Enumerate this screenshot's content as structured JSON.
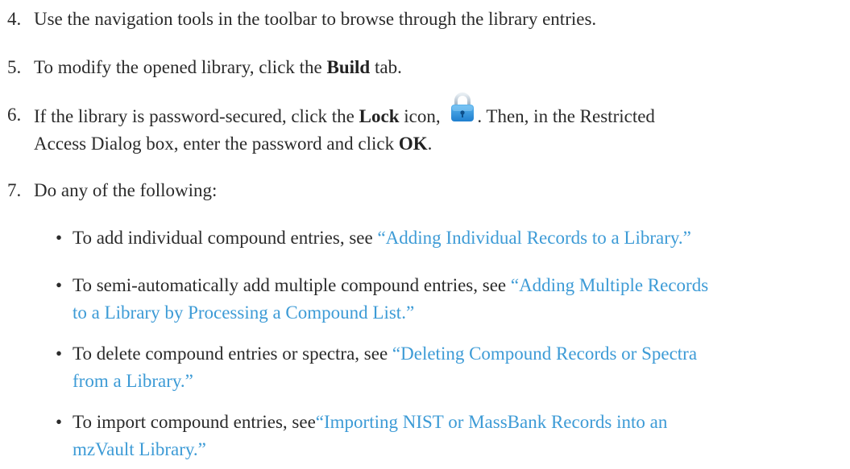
{
  "steps": [
    {
      "number": "4.",
      "text": "Use the navigation tools in the toolbar to browse through the library entries."
    },
    {
      "number": "5.",
      "pre": "To modify the opened library, click the ",
      "bold": "Build",
      "post": " tab."
    },
    {
      "number": "6.",
      "pre": "If the library is password-secured, click the ",
      "bold_lock": "Lock",
      "mid": " icon, ",
      "post1": ". Then, in the Restricted",
      "line2_pre": "Access Dialog box, enter the password and click ",
      "bold_ok": "OK",
      "line2_post": "."
    },
    {
      "number": "7.",
      "text": "Do any of the following:"
    }
  ],
  "bullets": [
    {
      "glyph": "•",
      "pre": "To add individual compound entries, see ",
      "link": "“Adding Individual Records to a Library.”"
    },
    {
      "glyph": "•",
      "pre": "To semi-automatically add multiple compound entries, see ",
      "link1": "“Adding Multiple Records",
      "link2": "to a Library by Processing a Compound List.”"
    },
    {
      "glyph": "•",
      "pre": "To delete compound entries or spectra, see ",
      "link1": "“Deleting Compound Records or Spectra",
      "link2": "from a Library.”"
    },
    {
      "glyph": "•",
      "pre": "To import compound entries, see",
      "link1": "“Importing NIST or MassBank Records into an",
      "link2": "mzVault Library.”"
    }
  ],
  "icons": {
    "lock": "lock-icon",
    "lock_color": "#2a8fd8"
  },
  "colors": {
    "link": "#3d9bd6",
    "text": "#2b2b2b"
  }
}
